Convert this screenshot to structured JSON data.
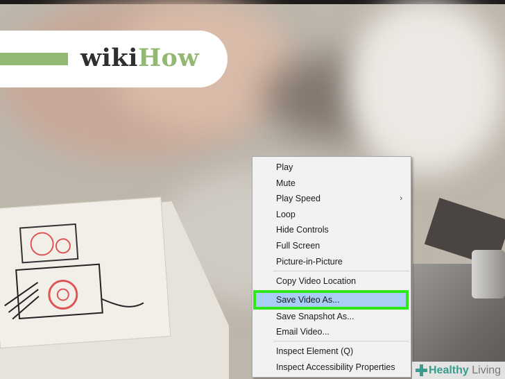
{
  "logo": {
    "wiki": "wiki",
    "how": "How"
  },
  "context_menu": {
    "items": [
      {
        "label": "Play"
      },
      {
        "label": "Mute"
      },
      {
        "label": "Play Speed",
        "submenu": true
      },
      {
        "label": "Loop"
      },
      {
        "label": "Hide Controls"
      },
      {
        "label": "Full Screen"
      },
      {
        "label": "Picture-in-Picture"
      },
      {
        "label": "Copy Video Location"
      },
      {
        "label": "Save Video As...",
        "highlighted": true
      },
      {
        "label": "Save Snapshot As..."
      },
      {
        "label": "Email Video..."
      },
      {
        "label": "Inspect Element (Q)"
      },
      {
        "label": "Inspect Accessibility Properties"
      }
    ],
    "submenu_arrow": "›"
  },
  "watermark": {
    "healthy": "Healthy",
    "living": "Living"
  },
  "colors": {
    "highlight": "#a9cef5",
    "annotation_box": "#2ee81a",
    "wikihow_green": "#93b874",
    "healthy_teal": "#3a9c8e"
  }
}
